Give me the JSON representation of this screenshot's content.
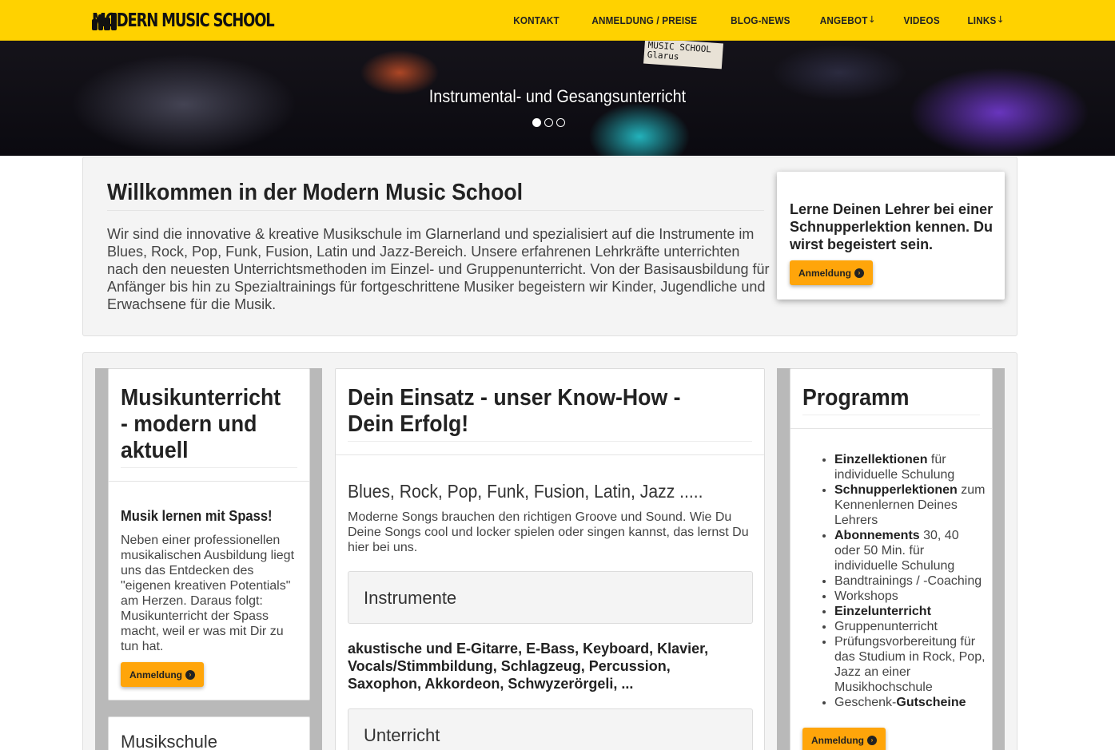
{
  "brand": {
    "logo_text": "MODERN MUSIC SCHOOL"
  },
  "nav": {
    "items": [
      {
        "label": "KONTAKT",
        "dropdown": false
      },
      {
        "label": "ANMELDUNG / PREISE",
        "dropdown": false
      },
      {
        "label": "BLOG-NEWS",
        "dropdown": false
      },
      {
        "label": "ANGEBOT",
        "dropdown": true
      },
      {
        "label": "VIDEOS",
        "dropdown": false
      },
      {
        "label": "LINKS",
        "dropdown": true
      }
    ]
  },
  "hero": {
    "caption": "Instrumental- und Gesangsunterricht",
    "banner_text": "MUSIC SCHOOL Glarus",
    "slides": 3,
    "active_slide": 1
  },
  "welcome": {
    "title": "Willkommen in der Modern Music School",
    "text": "Wir sind die innovative & kreative Musikschule im Glarnerland und spezialisiert auf die Instrumente im Blues, Rock, Pop, Funk, Fusion, Latin und Jazz-Bereich. Unsere erfahrenen Lehrkräfte unterrichten nach den neuesten Unterrichtsmethoden im Einzel- und Gruppenunterricht. Von der Basisausbildung für Anfänger bis hin zu Spezialtrainings für fortgeschrittene Musiker begeistern wir Kinder, Jugendliche und Erwachsene für die Musik.",
    "promo": {
      "text": "Lerne Deinen Lehrer bei einer Schnupperlektion kennen. Du wirst begeistert sein.",
      "button": "Anmeldung"
    }
  },
  "col1": {
    "title": "Musikunterricht - modern und aktuell",
    "subtitle": "Musik lernen mit Spass!",
    "text": "Neben einer professionellen musikalischen Ausbildung liegt uns das Entdecken des \"eigenen kreativen Potentials\" am Herzen. Daraus folgt: Musikunterricht der Spass macht, weil er was mit Dir zu tun hat.",
    "button": "Anmeldung",
    "next_title": "Musikschule"
  },
  "col2": {
    "title": "Dein Einsatz - unser Know-How - Dein Erfolg!",
    "lead": "Blues, Rock, Pop, Funk, Fusion, Latin, Jazz .....",
    "text": "Moderne Songs brauchen den richtigen Groove und Sound. Wie Du Deine Songs cool und locker spielen oder singen kannst, das lernst Du hier bei uns.",
    "panel1": "Instrumente",
    "instruments": "akustische und E-Gitarre, E-Bass, Keyboard, Klavier, Vocals/Stimmbildung, Schlagzeug, Percussion, Saxophon, Akkordeon, Schwyzerörgeli, ...",
    "panel2": "Unterricht"
  },
  "col3": {
    "title": "Programm",
    "items": [
      {
        "bold": "Einzellektionen",
        "rest": " für individuelle Schulung"
      },
      {
        "bold": "Schnupperlektionen",
        "rest": " zum Kennenlernen Deines Lehrers"
      },
      {
        "bold": "Abonnements",
        "rest": " 30, 40 oder 50 Min. für individuelle Schulung"
      },
      {
        "bold": "",
        "rest": "Bandtrainings / -Coaching"
      },
      {
        "bold": "",
        "rest": "Workshops"
      },
      {
        "bold": "Einzelunterricht",
        "rest": ""
      },
      {
        "bold": "",
        "rest": "Gruppenunterricht"
      },
      {
        "bold": "",
        "rest": "Prüfungsvorbereitung für das Studium in Rock, Pop, Jazz an einer Musikhochschule"
      },
      {
        "bold": "",
        "rest": "Geschenk-",
        "bold2": "Gutscheine"
      }
    ],
    "button": "Anmeldung"
  },
  "colors": {
    "accent": "#ffd200",
    "button": "#ffa50a"
  },
  "icons": {
    "dropdown": "arrow-down-icon",
    "button": "chevron-circle-right-icon"
  }
}
